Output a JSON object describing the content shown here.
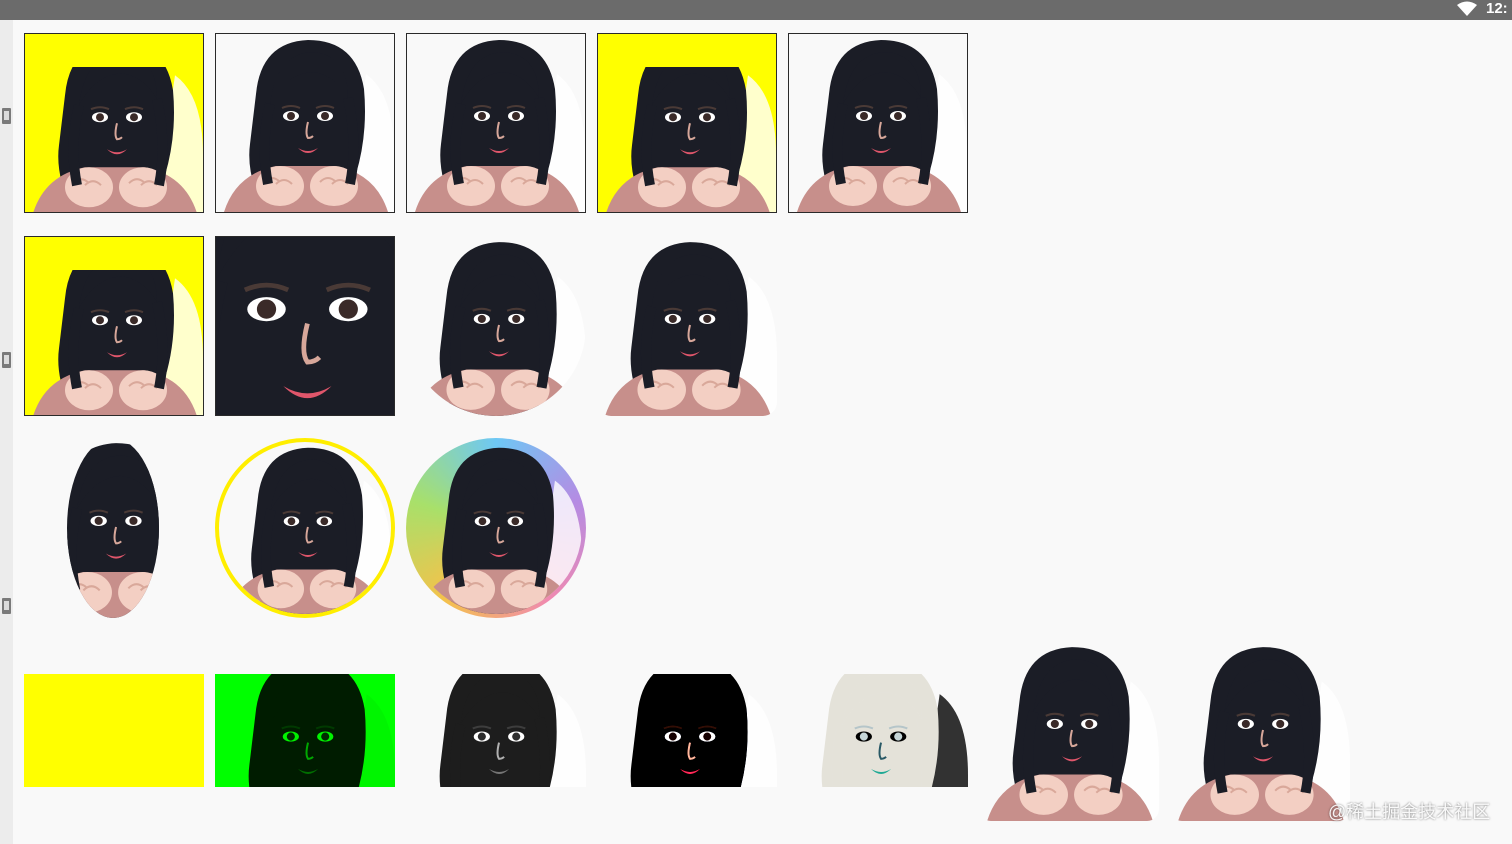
{
  "status_bar": {
    "time": "12:",
    "icons": [
      "wifi-icon"
    ]
  },
  "side_icons": [
    "image-icon",
    "image-icon",
    "image-icon"
  ],
  "colors": {
    "letterbox": "#ffff00",
    "green_tint": "#00ff00",
    "yellow_border": "#ffee00",
    "gradient_border": [
      "#6ec8f5",
      "#b58be3",
      "#f08ab0",
      "#f4c24b",
      "#a8e06a"
    ],
    "background": "#f9f9f9"
  },
  "image_rows": [
    [
      "image-fit-center-letterbox",
      "image-center-crop",
      "image-fit-xy",
      "image-fit-start-letterbox",
      "image-fit-end"
    ],
    [
      "image-fit-center-letterbox",
      "image-zoomed-face",
      "image-circle",
      "image-rounded-corners"
    ],
    [
      "image-oval",
      "image-circle-yellow-border",
      "image-circle-gradient-border"
    ],
    [
      "image-solid-yellow",
      "image-green-tint",
      "image-grayscale",
      "image-high-contrast",
      "image-inverted",
      "image-rounded-large",
      "image-rounded-large-2"
    ]
  ],
  "watermark": "@稀土掘金技术社区"
}
